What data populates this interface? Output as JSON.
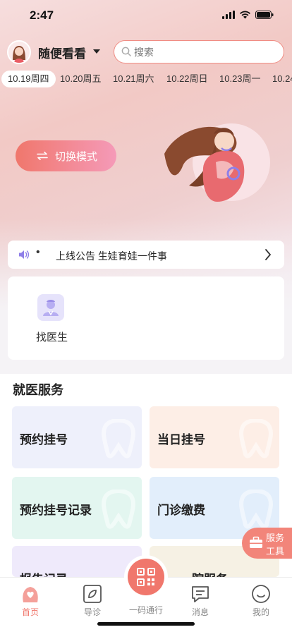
{
  "status": {
    "time": "2:47"
  },
  "header": {
    "username": "随便看看",
    "search_placeholder": "搜索"
  },
  "dates": [
    {
      "label": "10.19周四",
      "active": true
    },
    {
      "label": "10.20周五",
      "active": false
    },
    {
      "label": "10.21周六",
      "active": false
    },
    {
      "label": "10.22周日",
      "active": false
    },
    {
      "label": "10.23周一",
      "active": false
    },
    {
      "label": "10.24",
      "active": false
    }
  ],
  "hero": {
    "switch_label": "切换模式"
  },
  "notice": {
    "bullet": "•",
    "text": "上线公告 生娃育娃一件事"
  },
  "quick": {
    "find_doctor": "找医生"
  },
  "services": {
    "title": "就医服务",
    "items": [
      {
        "label": "预约挂号",
        "bg": "#eef0fb"
      },
      {
        "label": "当日挂号",
        "bg": "#fdeee6"
      },
      {
        "label": "预约挂号记录",
        "bg": "#e3f6f0"
      },
      {
        "label": "门诊缴费",
        "bg": "#e2eefb"
      },
      {
        "label": "报告记录",
        "bg": "#efeafb"
      },
      {
        "label": "院服务",
        "bg": "#f6f1e4"
      }
    ]
  },
  "float_tool": {
    "line1": "服务",
    "line2": "工具"
  },
  "nav": {
    "items": [
      {
        "label": "首页",
        "icon": "home-icon",
        "active": true
      },
      {
        "label": "导诊",
        "icon": "compass-icon",
        "active": false
      },
      {
        "label": "一码通行",
        "icon": "qr-code-icon",
        "active": false
      },
      {
        "label": "消息",
        "icon": "message-icon",
        "active": false
      },
      {
        "label": "我的",
        "icon": "profile-icon",
        "active": false
      }
    ]
  },
  "colors": {
    "accent": "#f0776c",
    "accent_pink": "#f59ab8"
  }
}
